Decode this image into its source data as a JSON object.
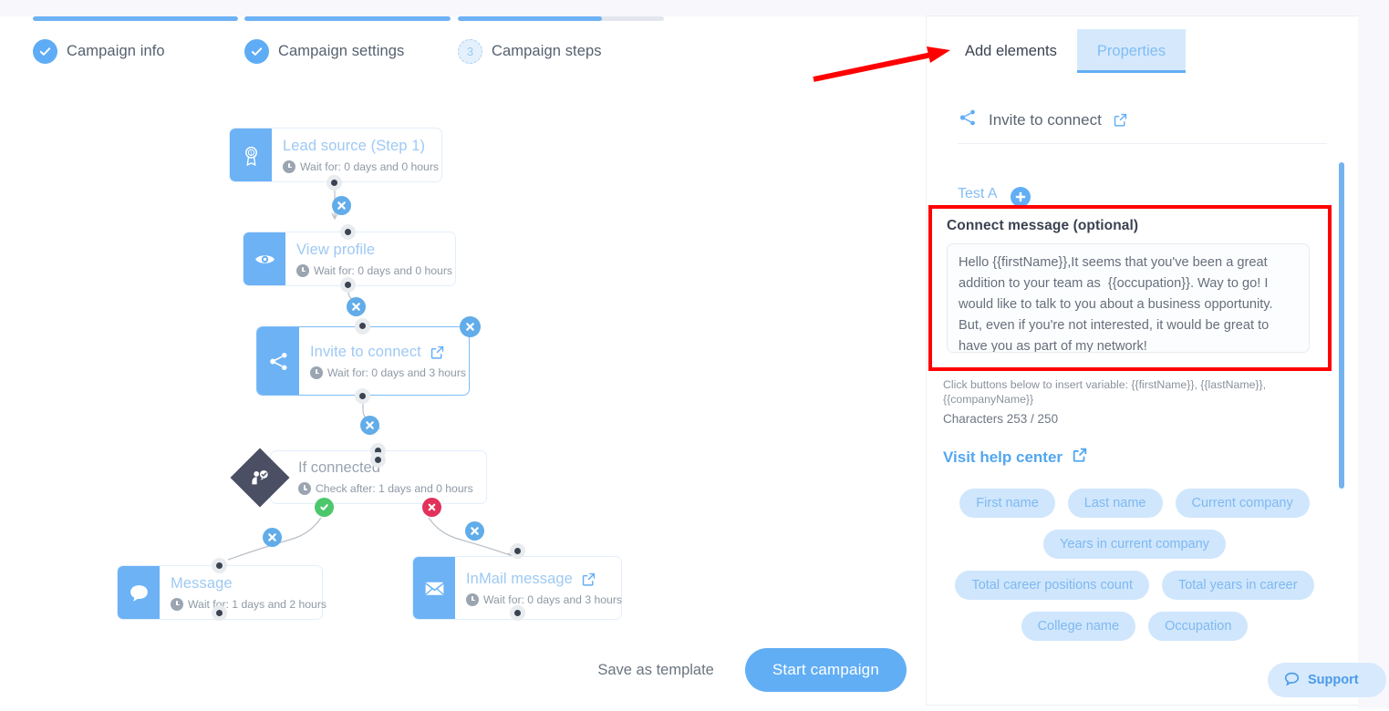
{
  "stepper": {
    "steps": [
      {
        "label": "Campaign info",
        "state": "done",
        "progress": 100,
        "marker": "check"
      },
      {
        "label": "Campaign settings",
        "state": "done",
        "progress": 100,
        "marker": "check"
      },
      {
        "label": "Campaign steps",
        "state": "current",
        "progress": 70,
        "marker": "3"
      }
    ]
  },
  "flow": {
    "nodes": [
      {
        "title": "Lead source (Step 1)",
        "subtitle": "Wait for: 0 days and 0 hours",
        "icon": "award-ribbon-icon",
        "has_external_link": false,
        "selected": false
      },
      {
        "title": "View profile",
        "subtitle": "Wait for: 0 days and 0 hours",
        "icon": "eye-icon",
        "has_external_link": false,
        "selected": false
      },
      {
        "title": "Invite to connect",
        "subtitle": "Wait for: 0 days and 3 hours",
        "icon": "share-icon",
        "has_external_link": true,
        "selected": true
      },
      {
        "title": "If connected",
        "subtitle": "Check after: 1 days and 0 hours",
        "icon": "person-check-icon",
        "has_external_link": false,
        "selected": false
      },
      {
        "title": "Message",
        "subtitle": "Wait for: 1 days and 2 hours",
        "icon": "chat-bubble-icon",
        "has_external_link": false,
        "selected": false
      },
      {
        "title": "InMail message",
        "subtitle": "Wait for: 0 days and 3 hours",
        "icon": "envelope-icon",
        "has_external_link": true,
        "selected": false
      }
    ]
  },
  "bottom_actions": {
    "save_template_label": "Save as template",
    "start_campaign_label": "Start campaign"
  },
  "panel": {
    "tabs": [
      {
        "label": "Add elements",
        "active": false
      },
      {
        "label": "Properties",
        "active": true
      }
    ],
    "element_title": "Invite to connect",
    "variant_tab": "Test A",
    "message": {
      "label": "Connect message (optional)",
      "value": "Hello {{firstName}},It seems that you've been a great addition to your team as  {{occupation}}. Way to go! I would like to talk to you about a business opportunity. But, even if you're not interested, it would be great to have you as part of my network!"
    },
    "hint": "Click buttons below to insert variable: {{firstName}}, {{lastName}}, {{companyName}}",
    "character_count": "Characters 253 / 250",
    "help_link": "Visit help center",
    "variable_chips": [
      "First name",
      "Last name",
      "Current company",
      "Years in current company",
      "Total career positions count",
      "Total years in career",
      "College name",
      "Occupation"
    ]
  },
  "support": {
    "label": "Support"
  },
  "colors": {
    "accent_blue": "#62aef5",
    "node_title_blue": "#9ec9f4",
    "annotation_red": "#ff0000",
    "yes_green": "#4cc76c",
    "no_red": "#e2315b",
    "chip_bg": "#cfe6fd",
    "diamond_dark": "#4a4f63"
  }
}
